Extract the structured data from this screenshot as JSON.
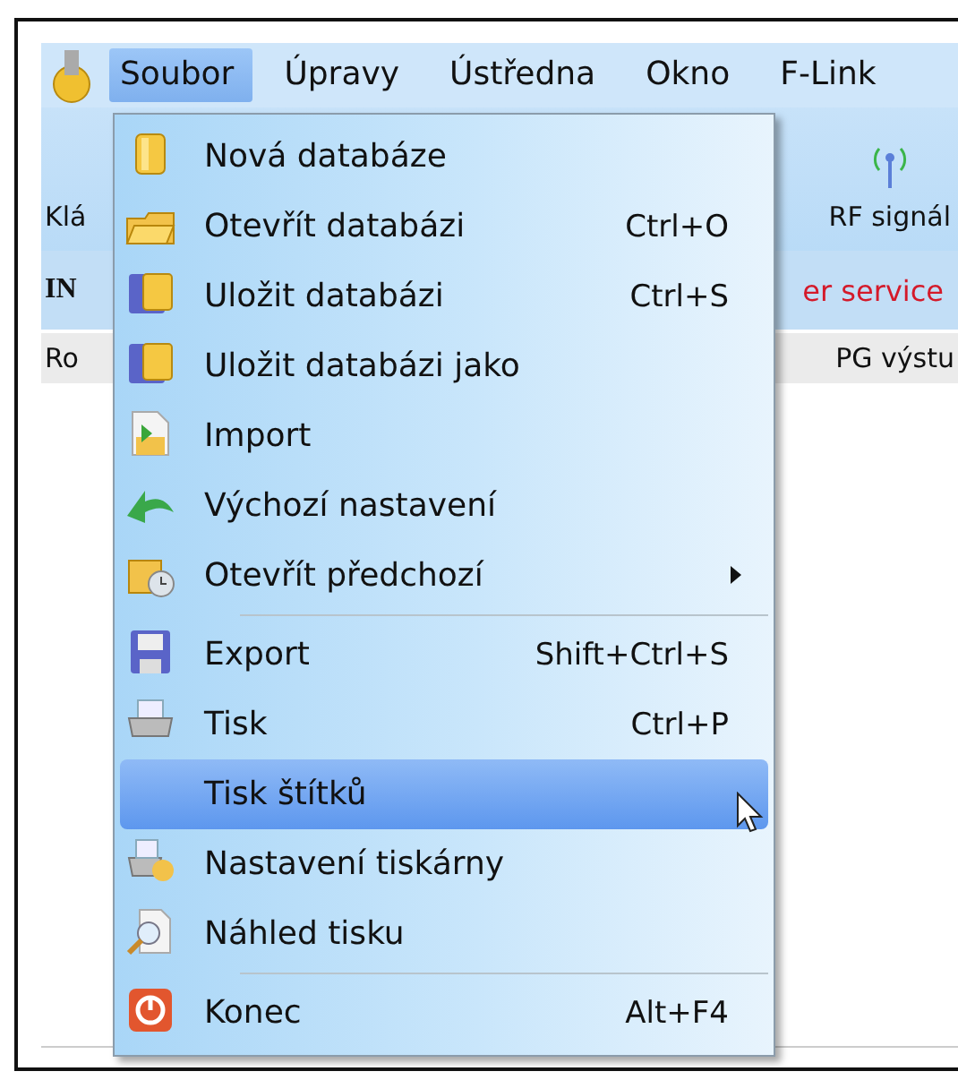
{
  "menubar": {
    "items": [
      {
        "label": "Soubor",
        "selected": true
      },
      {
        "label": "Úpravy",
        "selected": false
      },
      {
        "label": "Ústředna",
        "selected": false
      },
      {
        "label": "Okno",
        "selected": false
      },
      {
        "label": "F-Link",
        "selected": false
      }
    ]
  },
  "toolbar": {
    "left_label": "Klá",
    "right_label": "RF signál"
  },
  "info_row": {
    "code": "IN",
    "message": "er service"
  },
  "tabs": [
    {
      "label": "Ro"
    },
    {
      "label": "PG výstu"
    }
  ],
  "menu": {
    "items": [
      {
        "kind": "item",
        "label": "Nová databáze",
        "selected": false
      },
      {
        "kind": "item",
        "label": "Otevřít databázi",
        "shortcut": "Ctrl+O",
        "selected": false
      },
      {
        "kind": "item",
        "label": "Uložit databázi",
        "shortcut": "Ctrl+S",
        "selected": false
      },
      {
        "kind": "item",
        "label": "Uložit databázi jako",
        "selected": false
      },
      {
        "kind": "item",
        "label": "Import",
        "selected": false
      },
      {
        "kind": "item",
        "label": "Výchozí nastavení",
        "selected": false
      },
      {
        "kind": "item",
        "label": "Otevřít předchozí",
        "submenu": true,
        "selected": false
      },
      {
        "kind": "separator"
      },
      {
        "kind": "item",
        "label": "Export",
        "shortcut": "Shift+Ctrl+S",
        "selected": false
      },
      {
        "kind": "item",
        "label": "Tisk",
        "shortcut": "Ctrl+P",
        "selected": false
      },
      {
        "kind": "item",
        "label": "Tisk štítků",
        "selected": true
      },
      {
        "kind": "item",
        "label": "Nastavení tiskárny",
        "selected": false
      },
      {
        "kind": "item",
        "label": "Náhled tisku",
        "selected": false
      },
      {
        "kind": "separator"
      },
      {
        "kind": "item",
        "label": "Konec",
        "shortcut": "Alt+F4",
        "selected": false
      }
    ]
  }
}
